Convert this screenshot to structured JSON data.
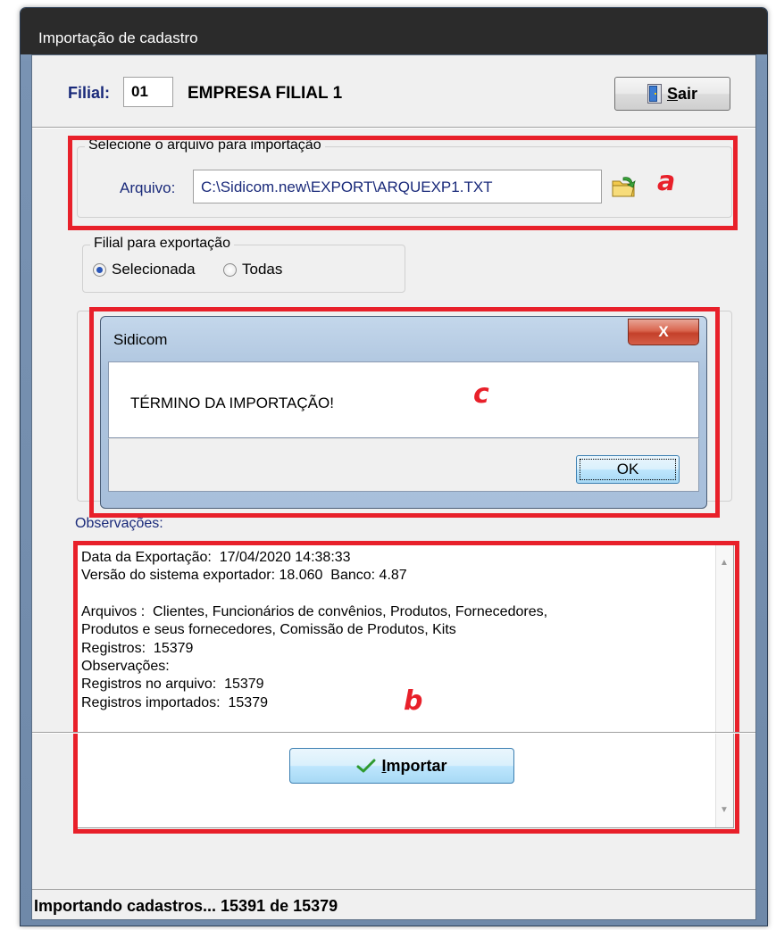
{
  "window": {
    "title": "Importação de cadastro"
  },
  "header": {
    "filial_label": "Filial:",
    "filial_code": "01",
    "empresa_name": "EMPRESA FILIAL 1",
    "sair_button": {
      "prefix": "",
      "accel": "S",
      "rest": "air",
      "icon": "door-exit-icon"
    }
  },
  "file_group": {
    "title": "Selecione o arquivo para importação",
    "arquivo_label": "Arquivo:",
    "arquivo_value": "C:\\Sidicom.new\\EXPORT\\ARQUEXP1.TXT",
    "open_icon": "open-folder-icon"
  },
  "export_group": {
    "title": "Filial para exportação",
    "options": [
      {
        "label": "Selecionada",
        "selected": true
      },
      {
        "label": "Todas",
        "selected": false
      }
    ]
  },
  "observacoes": {
    "label": "Observações:",
    "lines": [
      "Data da Exportação:  17/04/2020 14:38:33",
      "Versão do sistema exportador: 18.060  Banco: 4.87",
      "",
      "Arquivos :  Clientes, Funcionários de convênios, Produtos, Fornecedores,",
      "Produtos e seus fornecedores, Comissão de Produtos, Kits",
      "Registros:  15379",
      "Observações:",
      "Registros no arquivo:  15379",
      "Registros importados:  15379"
    ]
  },
  "importar_button": {
    "accel": "I",
    "rest": "mportar",
    "icon": "checkmark-icon"
  },
  "status_bar": {
    "text": "Importando cadastros... 15391 de 15379"
  },
  "message_box": {
    "title": "Sidicom",
    "close_label": "X",
    "message": "TÉRMINO DA IMPORTAÇÃO!",
    "ok_label": "OK"
  },
  "annotations": {
    "a": "a",
    "b": "b",
    "c": "c"
  },
  "colors": {
    "annotation_red": "#e8202a",
    "label_blue": "#1a2a7a",
    "title_bar": "#2b2b2b"
  }
}
